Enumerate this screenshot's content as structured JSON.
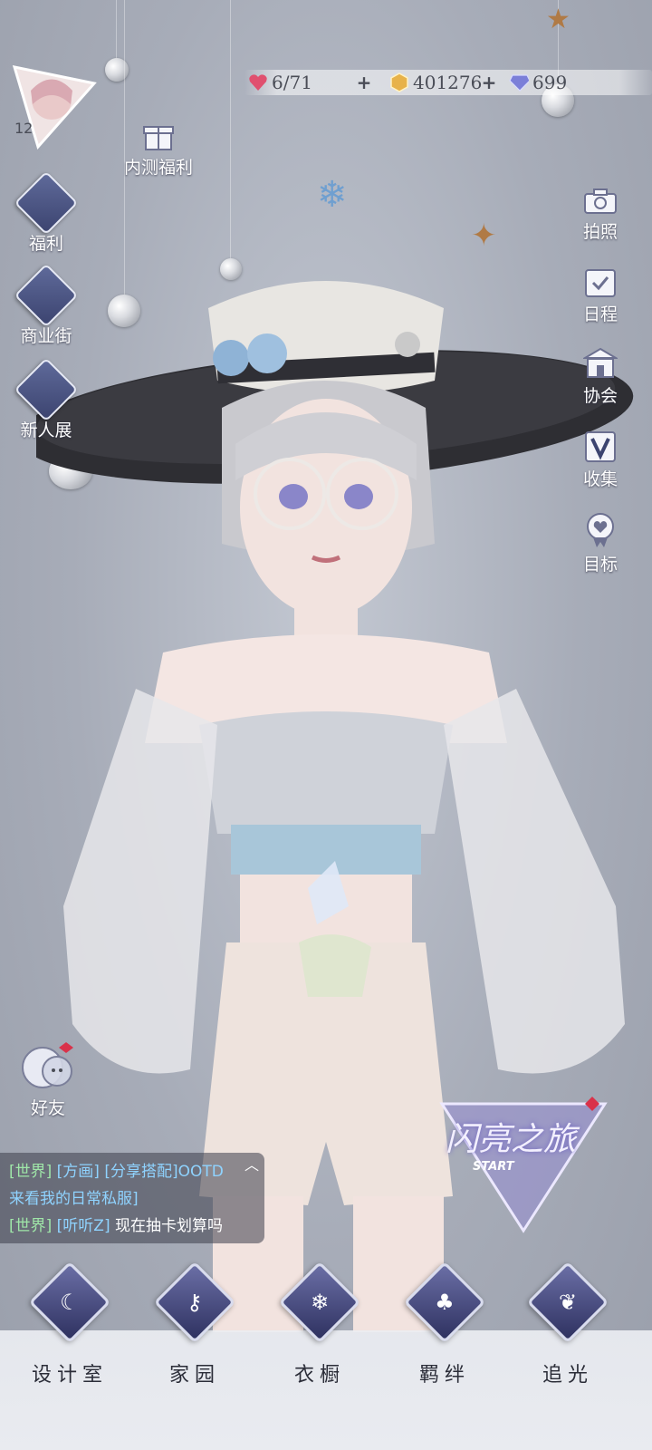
{
  "player": {
    "level": "12"
  },
  "currencies": {
    "stamina": "6/71",
    "gold": "401276",
    "diamond": "699"
  },
  "left_menu": {
    "beta_reward": "内测福利",
    "welfare": "福利",
    "shop_street": "商业街",
    "newcomer_show": "新人展"
  },
  "right_menu": {
    "photo": "拍照",
    "schedule": "日程",
    "guild": "协会",
    "collection": "收集",
    "goal": "目标"
  },
  "friends": "好友",
  "event_banner": {
    "title": "闪亮之旅",
    "subtitle": "START"
  },
  "chat": [
    {
      "channel": "[世界]",
      "user": "[方画]",
      "message": "[分享搭配]OOTD"
    },
    {
      "channel": "",
      "user": "",
      "message": "来看我的日常私服]"
    },
    {
      "channel": "[世界]",
      "user": "[听听Z]",
      "message": "现在抽卡划算吗"
    }
  ],
  "bottom_nav": [
    {
      "label": "设计室",
      "icon": "moon-icon"
    },
    {
      "label": "家园",
      "icon": "key-icon"
    },
    {
      "label": "衣橱",
      "icon": "snowflake-icon"
    },
    {
      "label": "羁绊",
      "icon": "clover-icon"
    },
    {
      "label": "追光",
      "icon": "butterfly-icon"
    }
  ],
  "colors": {
    "background": "#a7acb8",
    "accent": "#3c4470",
    "heart": "#e0506f",
    "gold": "#e7b24a",
    "diamond": "#7b7fd8"
  }
}
